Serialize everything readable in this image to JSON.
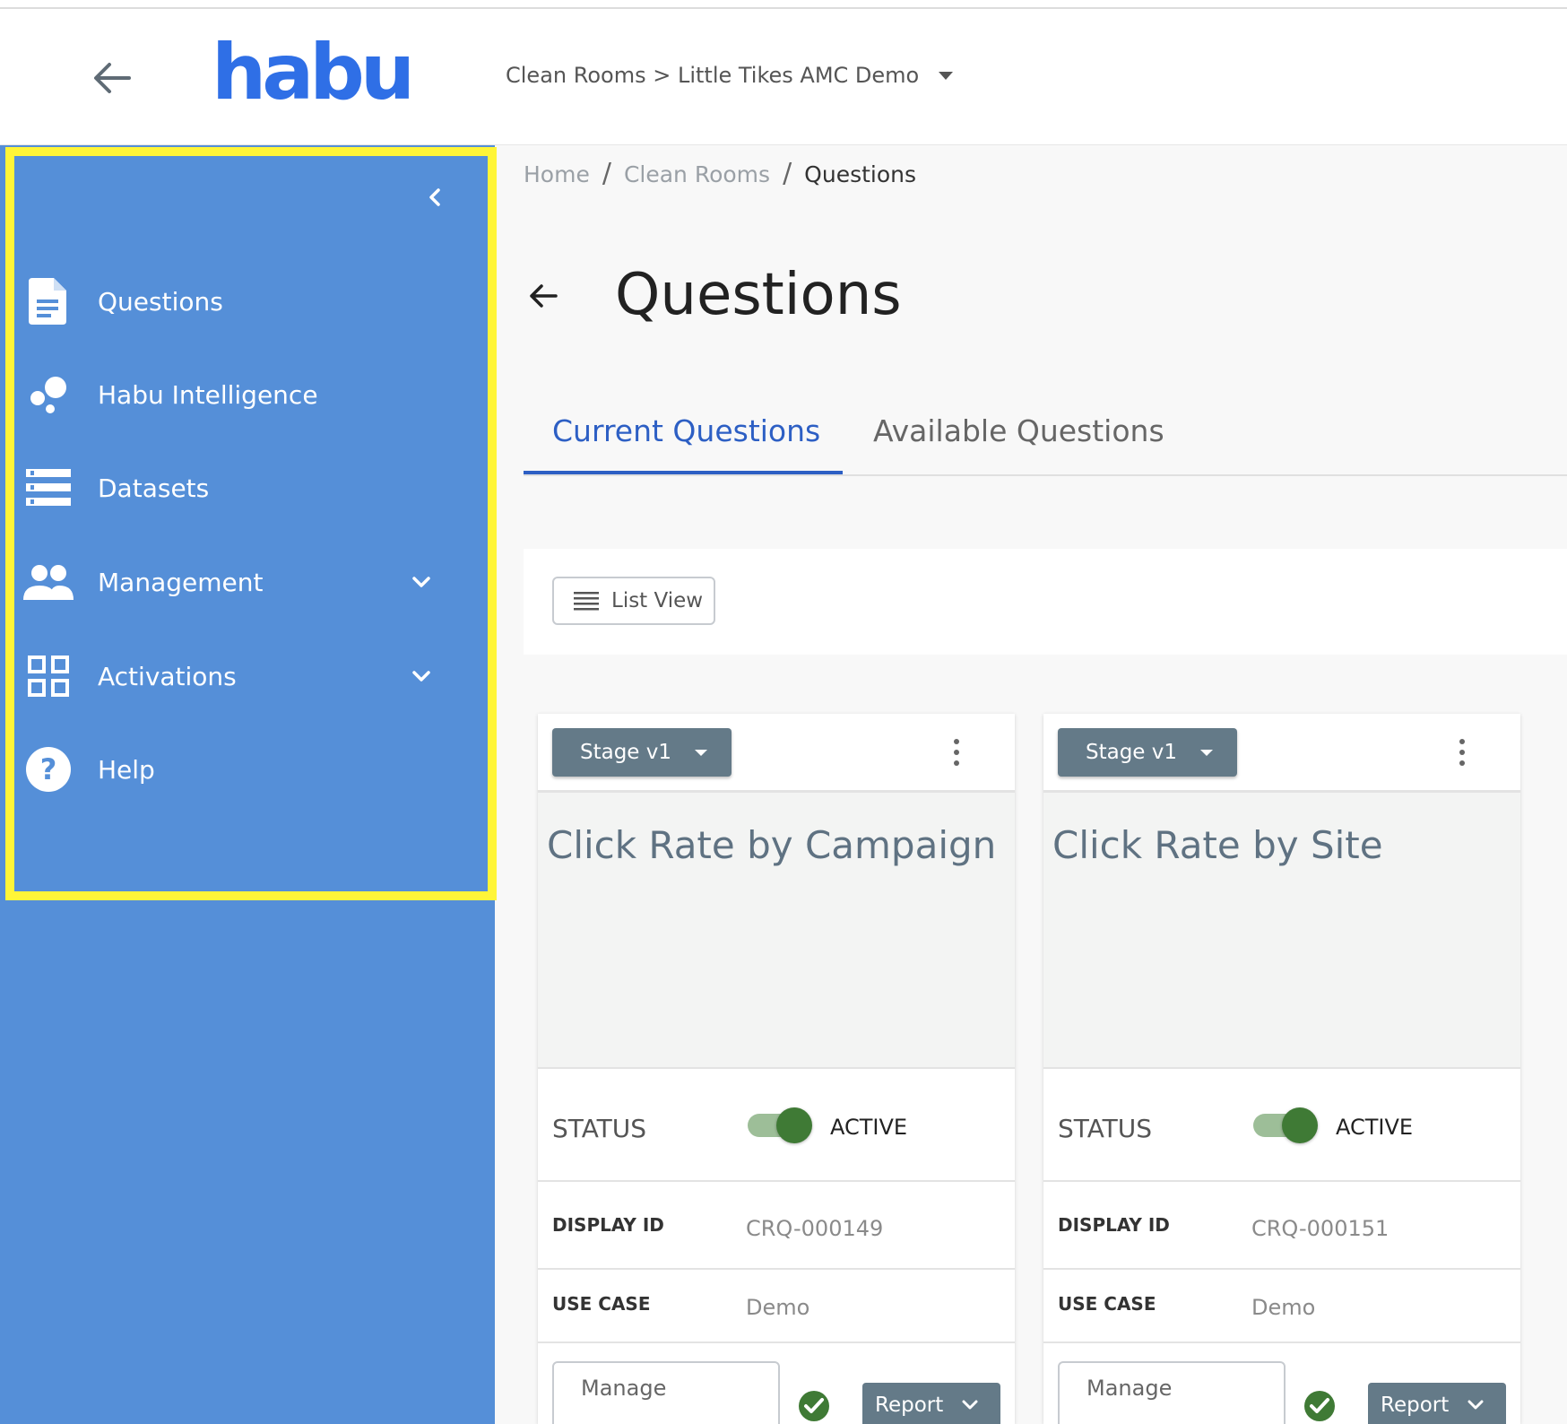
{
  "header": {
    "logo_text": "habu",
    "clean_room_path": "Clean Rooms > Little Tikes AMC Demo"
  },
  "sidebar": {
    "items": [
      {
        "label": "Questions",
        "icon": "document-icon"
      },
      {
        "label": "Habu Intelligence",
        "icon": "bubbles-icon"
      },
      {
        "label": "Datasets",
        "icon": "list-icon"
      },
      {
        "label": "Management",
        "icon": "people-icon",
        "expandable": true
      },
      {
        "label": "Activations",
        "icon": "grid-icon",
        "expandable": true
      },
      {
        "label": "Help",
        "icon": "help-icon"
      }
    ],
    "highlight_color": "#fff538",
    "background_color": "#558fd8"
  },
  "breadcrumb": {
    "home": "Home",
    "sep1": "/",
    "clean_rooms": "Clean Rooms",
    "sep2": "/",
    "current": "Questions"
  },
  "page": {
    "title": "Questions"
  },
  "tabs": {
    "current": "Current Questions",
    "available": "Available Questions"
  },
  "toolbar": {
    "list_view_label": "List View"
  },
  "cards": [
    {
      "stage": "Stage v1",
      "title": "Click Rate by Campaign",
      "status_label": "STATUS",
      "status_value": "ACTIVE",
      "display_id_label": "DISPLAY ID",
      "display_id": "CRQ-000149",
      "use_case_label": "USE CASE",
      "use_case": "Demo",
      "manage_label": "Manage",
      "report_label": "Report"
    },
    {
      "stage": "Stage v1",
      "title": "Click Rate by Site",
      "status_label": "STATUS",
      "status_value": "ACTIVE",
      "display_id_label": "DISPLAY ID",
      "display_id": "CRQ-000151",
      "use_case_label": "USE CASE",
      "use_case": "Demo",
      "manage_label": "Manage",
      "report_label": "Report"
    }
  ],
  "colors": {
    "accent": "#2d5fc4",
    "logo": "#2f6fe6",
    "toggle_active": "#3f7a35",
    "button_gray": "#647a88"
  }
}
